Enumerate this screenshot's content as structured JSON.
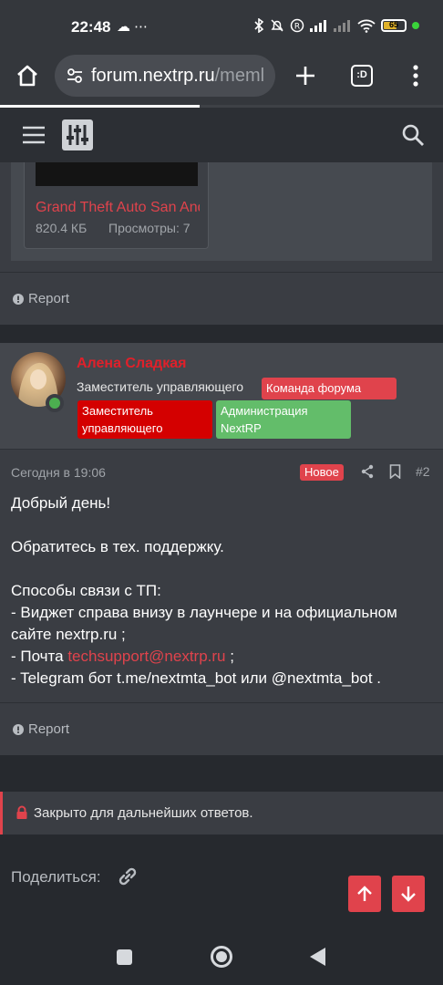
{
  "status_bar": {
    "time": "22:48",
    "left_icons": "☁ ⋯",
    "battery_level": "65",
    "battery_fraction": 0.65,
    "icons": [
      "bluetooth-icon",
      "alarm-off-icon",
      "registered-icon",
      "signal-icon",
      "signal-2-icon",
      "wifi-icon",
      "battery-icon",
      "active-dot-icon"
    ]
  },
  "browser": {
    "url_host": "forum.nextrp.ru",
    "url_path": "/meml",
    "tab_count": ":D",
    "load_progress": 0.45
  },
  "post1": {
    "attachment_name": "Grand Theft Auto San Andreas",
    "attachment_size": "820.4 КБ",
    "attachment_views": "Просмотры: 7",
    "report_label": "Report"
  },
  "post2": {
    "username": "Алена Сладкая",
    "user_title": "Заместитель управляющего",
    "badges": {
      "team": "Команда форума",
      "deputy": "Заместитель управляющего",
      "admin": "Администрация NextRP"
    },
    "date": "Сегодня в 19:06",
    "new_label": "Новое",
    "post_number": "#2",
    "body": {
      "greeting": "Добрый день!",
      "advice": "Обратитесь в тех. поддержку.",
      "ways_title": "Способы связи с ТП:",
      "way1_a": "- Виджет справа внизу в лаунчере и на официальном",
      "way1_b": "сайте nextrp.ru ;",
      "way2_prefix": "- Почта ",
      "way2_email": "techsupport@nextrp.ru",
      "way2_suffix": " ;",
      "way3": "- Telegram бот t.me/nextmta_bot или @nextmta_bot ."
    },
    "report_label": "Report"
  },
  "closed_notice": "Закрыто для дальнейших ответов.",
  "share_label": "Поделиться:",
  "colors": {
    "accent": "#e0434c",
    "username": "#e0202a",
    "deputy_badge": "#d40000",
    "admin_badge": "#63bd6a",
    "online": "#4caf50"
  }
}
